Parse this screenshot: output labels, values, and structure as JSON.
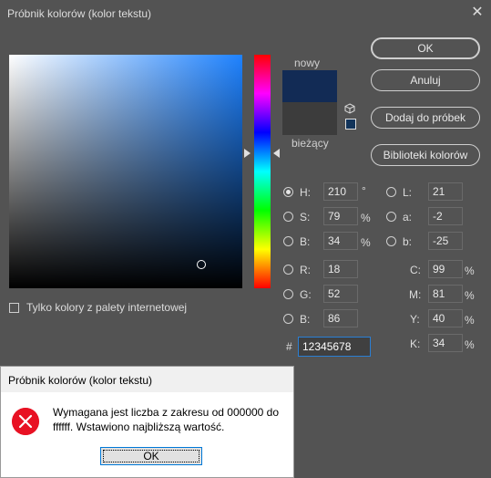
{
  "window": {
    "title": "Próbnik kolorów (kolor tekstu)",
    "close_glyph": "✕"
  },
  "preview": {
    "new_label": "nowy",
    "current_label": "bieżący"
  },
  "buttons": {
    "ok": "OK",
    "cancel": "Anuluj",
    "add_swatch": "Dodaj do próbek",
    "libraries": "Biblioteki kolorów"
  },
  "web_only": {
    "label": "Tylko kolory z palety internetowej"
  },
  "hsb": {
    "h": {
      "label": "H:",
      "value": "210",
      "unit": "°"
    },
    "s": {
      "label": "S:",
      "value": "79",
      "unit": "%"
    },
    "b": {
      "label": "B:",
      "value": "34",
      "unit": "%"
    }
  },
  "lab": {
    "l": {
      "label": "L:",
      "value": "21"
    },
    "a": {
      "label": "a:",
      "value": "-2"
    },
    "b": {
      "label": "b:",
      "value": "-25"
    }
  },
  "rgb": {
    "r": {
      "label": "R:",
      "value": "18"
    },
    "g": {
      "label": "G:",
      "value": "52"
    },
    "b": {
      "label": "B:",
      "value": "86"
    }
  },
  "cmyk": {
    "c": {
      "label": "C:",
      "value": "99",
      "unit": "%"
    },
    "m": {
      "label": "M:",
      "value": "81",
      "unit": "%"
    },
    "y": {
      "label": "Y:",
      "value": "40",
      "unit": "%"
    },
    "k": {
      "label": "K:",
      "value": "34",
      "unit": "%"
    }
  },
  "hex": {
    "prefix": "#",
    "value": "12345678"
  },
  "colors": {
    "new": "#122b55",
    "current": "#3c3c3c",
    "accent": "#2a7fd4"
  },
  "error_dialog": {
    "title": "Próbnik kolorów (kolor tekstu)",
    "message": "Wymagana jest liczba z zakresu od 000000 do ffffff. Wstawiono najbliższą wartość.",
    "ok": "OK",
    "icon": "error-icon"
  }
}
